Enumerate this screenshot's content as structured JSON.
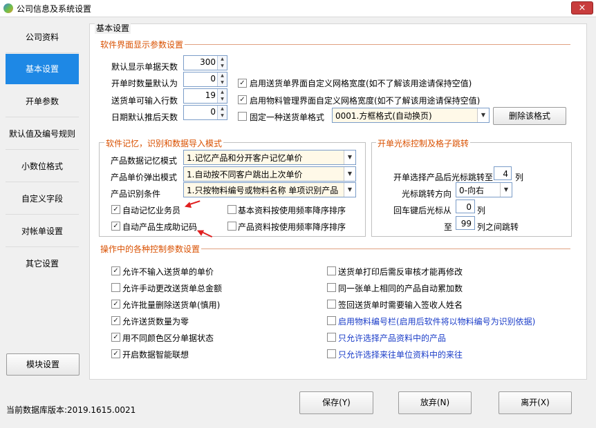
{
  "window": {
    "title": "公司信息及系统设置",
    "close": "×"
  },
  "nav": {
    "items": [
      "公司资料",
      "基本设置",
      "开单参数",
      "默认值及编号规则",
      "小数位格式",
      "自定义字段",
      "对帐单设置",
      "其它设置"
    ],
    "module_button": "模块设置"
  },
  "panel": {
    "title": "基本设置"
  },
  "display": {
    "legend": "软件界面显示参数设置",
    "fields": [
      {
        "label": "默认显示单据天数",
        "value": "300"
      },
      {
        "label": "开单时数量默认为",
        "value": "0"
      },
      {
        "label": "送货单可输入行数",
        "value": "19"
      },
      {
        "label": "日期默认推后天数",
        "value": "0"
      }
    ],
    "checks": [
      {
        "label": "启用送货单界面自定义网格宽度(如不了解该用途请保持空值)",
        "checked": true
      },
      {
        "label": "启用物料管理界面自定义网格宽度(如不了解该用途请保持空值)",
        "checked": true
      },
      {
        "label": "固定一种送货单格式",
        "checked": false
      }
    ],
    "format_value": "0001.方框格式(自动换页)",
    "delete_format_button": "删除该格式"
  },
  "memory": {
    "legend": "软件记忆，识别和数据导入模式",
    "rows": [
      {
        "label": "产品数据记忆模式",
        "value": "1.记忆产品和分开客户记忆单价"
      },
      {
        "label": "产品单价弹出模式",
        "value": "1.自动按不同客户跳出上次单价"
      },
      {
        "label": "产品识别条件",
        "value": "1.只按物料编号或物料名称 单项识别产品"
      }
    ],
    "checks": [
      {
        "label": "自动记忆业务员",
        "checked": true
      },
      {
        "label": "基本资料按使用频率降序排序",
        "checked": false
      },
      {
        "label": "自动产品生成助记码",
        "checked": true
      },
      {
        "label": "产品资料按使用频率降序排序",
        "checked": false
      }
    ]
  },
  "cursor": {
    "legend": "开单光标控制及格子跳转",
    "jump_label": "开单选择产品后光标跳转至",
    "jump_value": "4",
    "jump_unit": "列",
    "direction_label": "光标跳转方向",
    "direction_value": "0-向右",
    "enter_label": "回车键后光标从",
    "enter_value": "0",
    "enter_unit": "列",
    "to_label": "至",
    "to_value": "99",
    "to_unit": "列之间跳转"
  },
  "control": {
    "legend": "操作中的各种控制参数设置",
    "left": [
      {
        "label": "允许不输入送货单的单价",
        "checked": true
      },
      {
        "label": "允许手动更改送货单总金额",
        "checked": false
      },
      {
        "label": "允许批量删除送货单(慎用)",
        "checked": true
      },
      {
        "label": "允许送货数量为零",
        "checked": true
      },
      {
        "label": "用不同颜色区分单据状态",
        "checked": true
      },
      {
        "label": "开启数据智能联想",
        "checked": true
      }
    ],
    "right": [
      {
        "label": "送货单打印后需反审核才能再修改",
        "checked": false
      },
      {
        "label": "同一张单上相同的产品自动累加数",
        "checked": false
      },
      {
        "label": "签回送货单时需要输入签收人姓名",
        "checked": false
      },
      {
        "label": "启用物料编号栏(启用后软件将以物料编号为识别依据)",
        "checked": false
      },
      {
        "label": "只允许选择产品资料中的产品",
        "checked": false
      },
      {
        "label": "只允许选择来往单位资料中的来往",
        "checked": false
      }
    ]
  },
  "footer": {
    "version": "当前数据库版本:2019.1615.0021",
    "save": "保存(Y)",
    "discard": "放弃(N)",
    "exit": "离开(X)"
  }
}
